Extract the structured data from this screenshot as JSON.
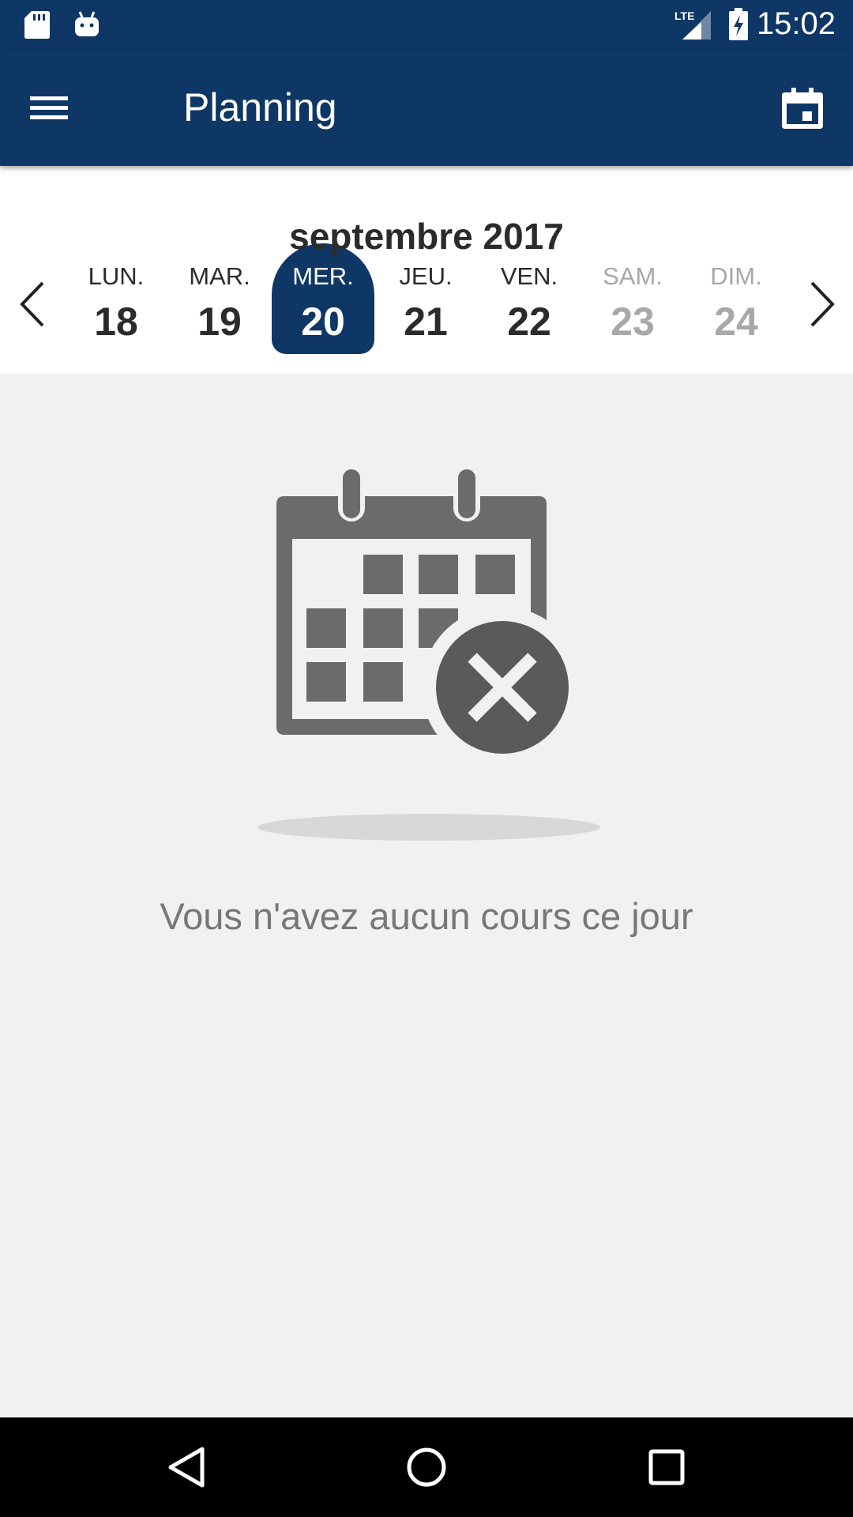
{
  "status_bar": {
    "time": "15:02",
    "network": "LTE",
    "icons": [
      "sd-card-icon",
      "android-icon",
      "signal-icon",
      "battery-charging-icon"
    ]
  },
  "app_bar": {
    "title": "Planning",
    "menu_icon": "hamburger-menu-icon",
    "calendar_icon": "calendar-today-icon"
  },
  "week": {
    "month_label": "septembre 2017",
    "prev_icon": "chevron-left-icon",
    "next_icon": "chevron-right-icon",
    "days": [
      {
        "name": "LUN.",
        "number": "18",
        "state": "normal"
      },
      {
        "name": "MAR.",
        "number": "19",
        "state": "normal"
      },
      {
        "name": "MER.",
        "number": "20",
        "state": "selected"
      },
      {
        "name": "JEU.",
        "number": "21",
        "state": "normal"
      },
      {
        "name": "VEN.",
        "number": "22",
        "state": "normal"
      },
      {
        "name": "SAM.",
        "number": "23",
        "state": "weekend"
      },
      {
        "name": "DIM.",
        "number": "24",
        "state": "weekend"
      }
    ]
  },
  "empty_state": {
    "icon": "calendar-remove-icon",
    "message": "Vous n'avez aucun cours ce jour"
  },
  "navigation_bar": {
    "buttons": [
      "back-icon",
      "home-icon",
      "recents-icon"
    ]
  },
  "colors": {
    "primary": "#0e3766",
    "background": "#f1f1f1",
    "weekend_text": "#a8a8a8",
    "empty_icon": "#6b6b6b"
  }
}
